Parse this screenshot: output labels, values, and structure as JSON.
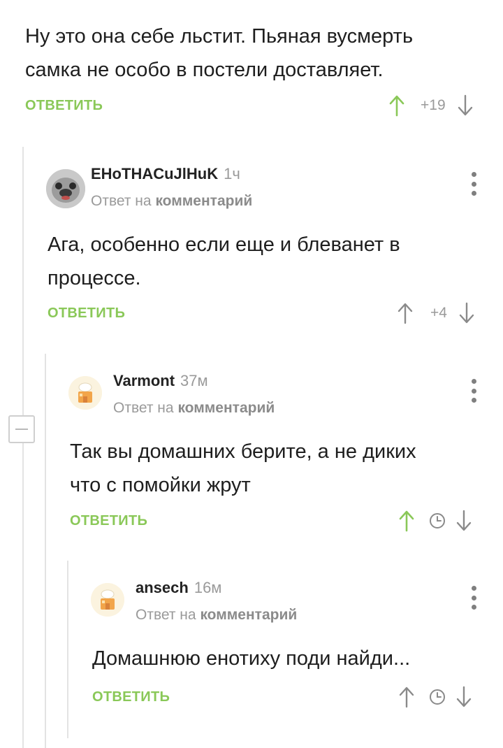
{
  "comments": [
    {
      "text_lines": [
        "Ну это она себе льстит. Пьяная вусмерть",
        "самка не особо в постели доставляет."
      ],
      "reply_label": "ОТВЕТИТЬ",
      "rating": "+19"
    },
    {
      "author": "EHoTHACuJlHuK",
      "time": "1ч",
      "reply_prefix": "Ответ на",
      "reply_target": "комментарий",
      "text_lines": [
        "Ага, особенно если еще и блеванет в",
        "процессе."
      ],
      "reply_label": "ОТВЕТИТЬ",
      "rating": "+4"
    },
    {
      "author": "Varmont",
      "time": "37м",
      "reply_prefix": "Ответ на",
      "reply_target": "комментарий",
      "text_lines": [
        "Так вы домашних берите, а не диких",
        "что с помойки жрут"
      ],
      "reply_label": "ОТВЕТИТЬ"
    },
    {
      "author": "ansech",
      "time": "16м",
      "reply_prefix": "Ответ на",
      "reply_target": "комментарий",
      "text_lines": [
        "Домашнюю енотиху поди найди..."
      ],
      "reply_label": "ОТВЕТИТЬ"
    }
  ],
  "icons": {
    "upvote": "arrow-up-icon",
    "downvote": "arrow-down-icon",
    "pending": "clock-icon",
    "menu": "more-vertical-icon",
    "collapse": "minus-icon"
  },
  "colors": {
    "accent_green": "#8ac858",
    "muted_gray": "#9a9a9a",
    "text": "#1e1e1e",
    "thread_line": "#e3e3e3"
  }
}
